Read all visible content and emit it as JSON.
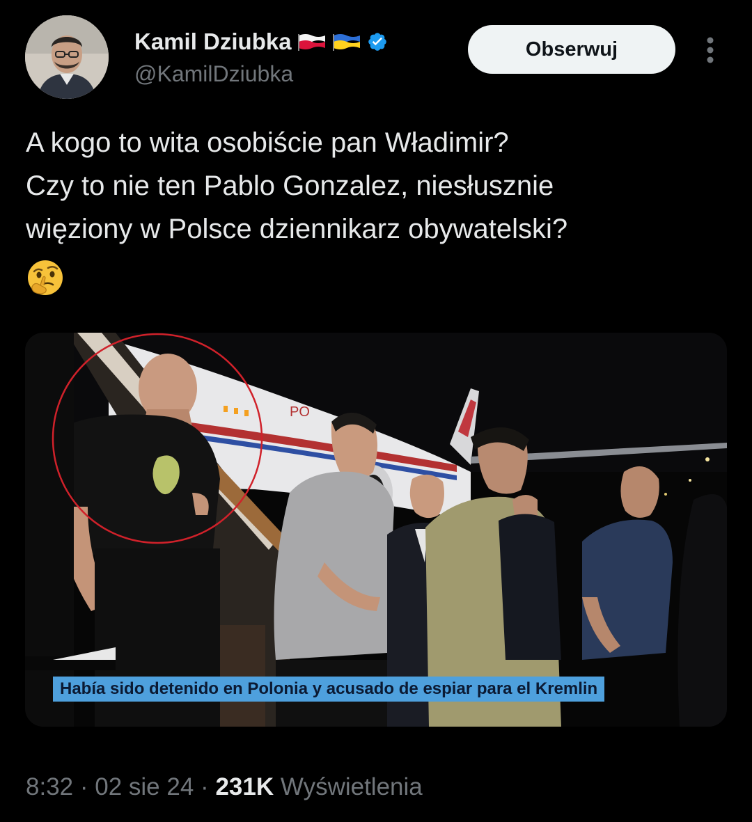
{
  "author": {
    "display_name": "Kamil Dziubka",
    "handle": "@KamilDziubka",
    "flags": [
      "poland-flag-icon",
      "ukraine-flag-icon"
    ],
    "verified_icon": "verified-badge-icon"
  },
  "actions": {
    "follow_label": "Obserwuj",
    "more_icon": "more-options-icon"
  },
  "tweet": {
    "lines": [
      "A kogo to wita osobiście pan Władimir?",
      "Czy to nie ten Pablo Gonzalez, niesłusznie",
      "więziony w Polsce dziennikarz obywatelski?"
    ],
    "emoji": "🤔",
    "emoji_icon": "thinking-face-icon"
  },
  "media": {
    "caption": "Había sido detenido en Polonia y acusado de espiar para el Kremlin",
    "plane_text": "PO"
  },
  "meta": {
    "time": "8:32",
    "separator": "·",
    "date": "02 sie 24",
    "views_count": "231K",
    "views_label": "Wyświetlenia"
  },
  "colors": {
    "background": "#000000",
    "text": "#e7e9ea",
    "secondary_text": "#71767b",
    "follow_bg": "#eff3f4",
    "verified": "#1d9bf0",
    "caption_bg": "#4ea0dd"
  }
}
